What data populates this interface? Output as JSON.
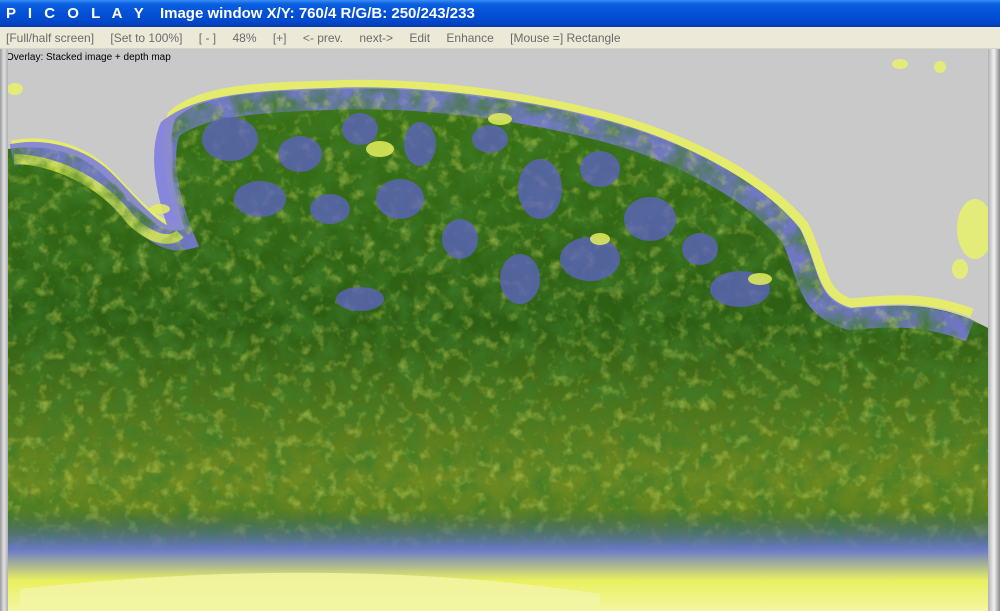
{
  "titlebar": {
    "app_name": "P I C O L A Y",
    "window_info": "Image window X/Y: 760/4 R/G/B: 250/243/233"
  },
  "menubar": {
    "items": [
      "[Full/half screen]",
      "[Set to 100%]",
      "[ - ]",
      "48%",
      "[+]",
      "<- prev.",
      "next->",
      "Edit",
      "Enhance",
      "[Mouse =] Rectangle"
    ]
  },
  "image": {
    "overlay_label": "Overlay: Stacked image + depth map",
    "colors": {
      "background": "#c9c9c9",
      "dark_green": "#1e4a12",
      "green": "#3f7a1c",
      "yellow_green": "#9aa82a",
      "yellow": "#e8f060",
      "blue_violet": "#6a6ad8",
      "light_blue": "#8a8ae8"
    }
  }
}
